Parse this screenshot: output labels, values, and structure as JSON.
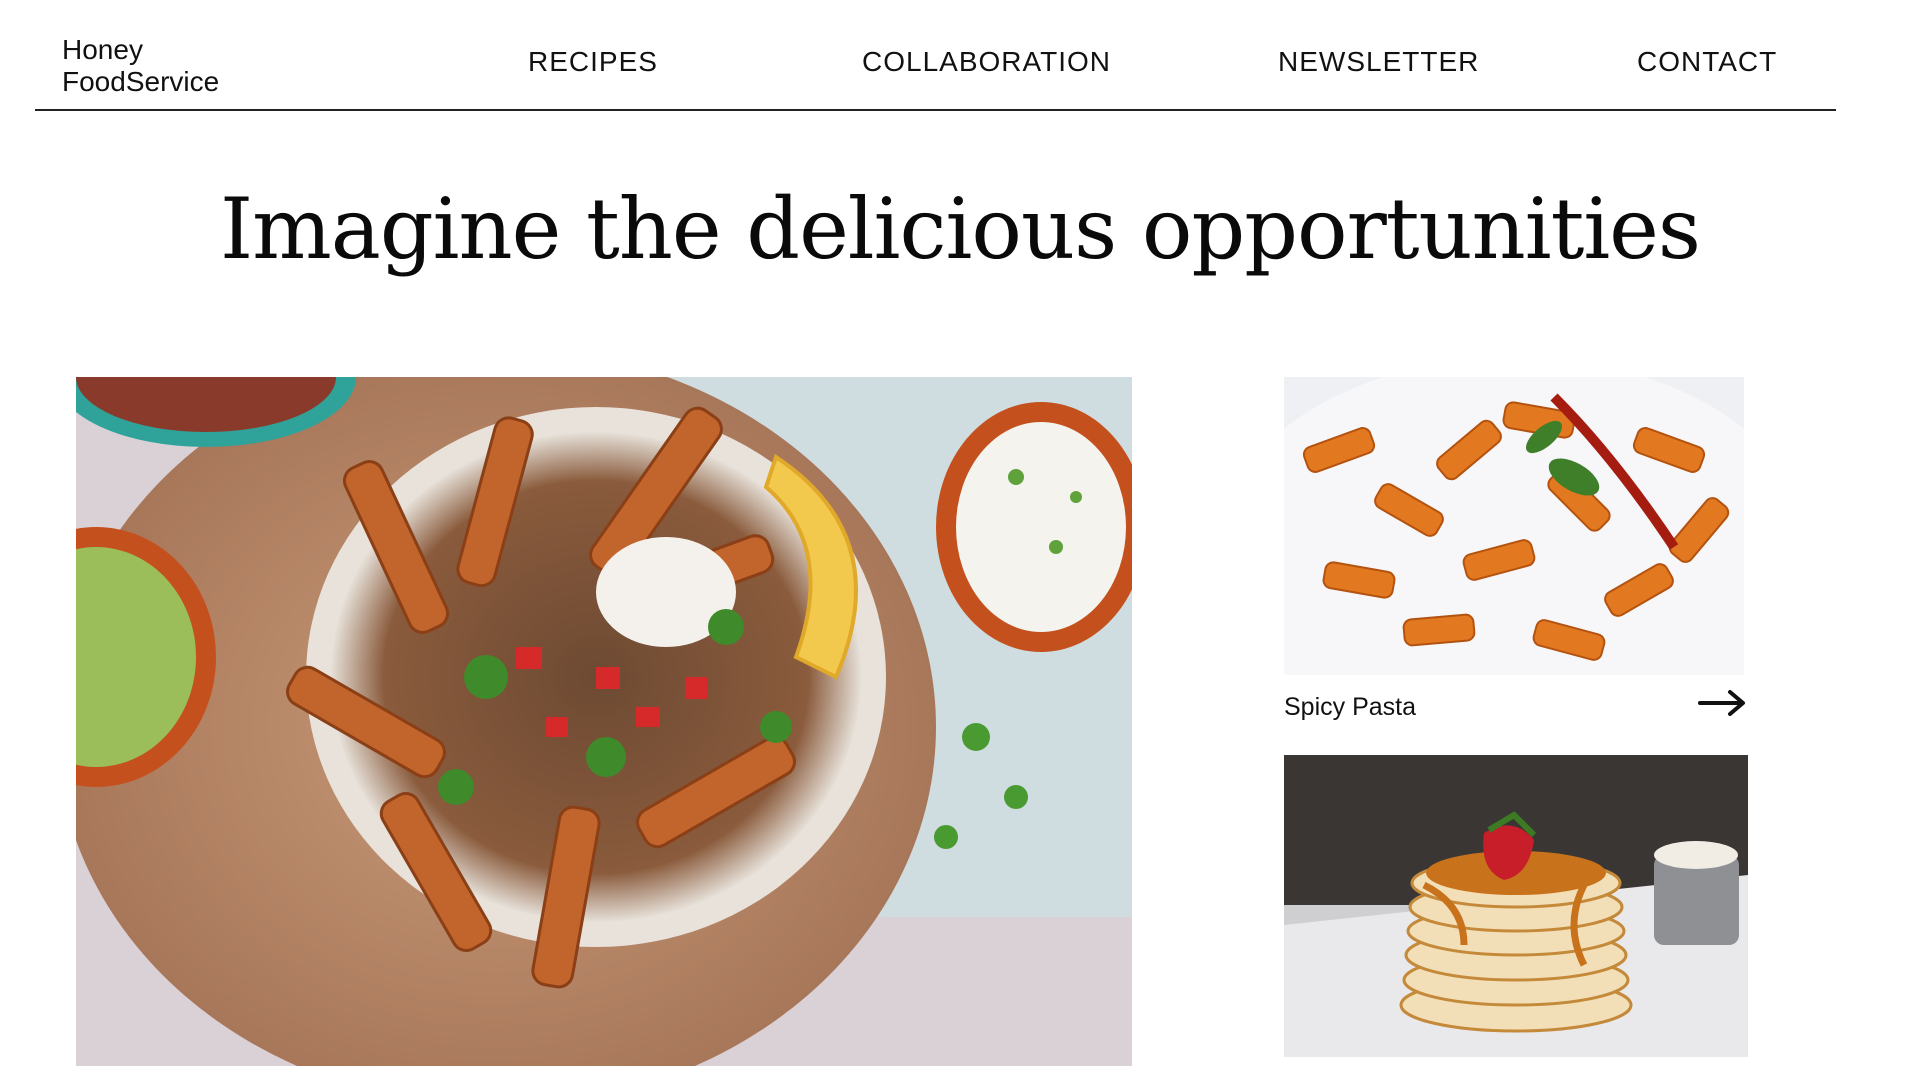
{
  "header": {
    "brand_line1": "Honey",
    "brand_line2": "FoodService",
    "nav": {
      "recipes": "RECIPES",
      "collaboration": "COLLABORATION",
      "newsletter": "NEWSLETTER",
      "contact": "CONTACT"
    }
  },
  "hero": {
    "title": "Imagine the delicious opportunities"
  },
  "cards": [
    {
      "label": "Spicy Pasta",
      "icon": "arrow-right-icon"
    }
  ],
  "colors": {
    "text": "#111111",
    "rule": "#222222",
    "background": "#ffffff"
  }
}
